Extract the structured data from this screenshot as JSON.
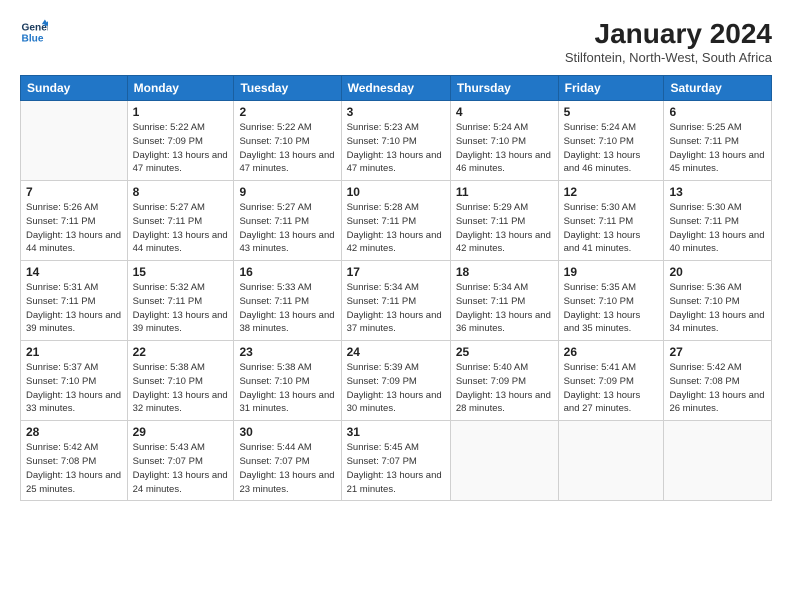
{
  "logo": {
    "line1": "General",
    "line2": "Blue"
  },
  "title": "January 2024",
  "location": "Stilfontein, North-West, South Africa",
  "days_header": [
    "Sunday",
    "Monday",
    "Tuesday",
    "Wednesday",
    "Thursday",
    "Friday",
    "Saturday"
  ],
  "weeks": [
    [
      {
        "day": "",
        "sunrise": "",
        "sunset": "",
        "daylight": ""
      },
      {
        "day": "1",
        "sunrise": "Sunrise: 5:22 AM",
        "sunset": "Sunset: 7:09 PM",
        "daylight": "Daylight: 13 hours and 47 minutes."
      },
      {
        "day": "2",
        "sunrise": "Sunrise: 5:22 AM",
        "sunset": "Sunset: 7:10 PM",
        "daylight": "Daylight: 13 hours and 47 minutes."
      },
      {
        "day": "3",
        "sunrise": "Sunrise: 5:23 AM",
        "sunset": "Sunset: 7:10 PM",
        "daylight": "Daylight: 13 hours and 47 minutes."
      },
      {
        "day": "4",
        "sunrise": "Sunrise: 5:24 AM",
        "sunset": "Sunset: 7:10 PM",
        "daylight": "Daylight: 13 hours and 46 minutes."
      },
      {
        "day": "5",
        "sunrise": "Sunrise: 5:24 AM",
        "sunset": "Sunset: 7:10 PM",
        "daylight": "Daylight: 13 hours and 46 minutes."
      },
      {
        "day": "6",
        "sunrise": "Sunrise: 5:25 AM",
        "sunset": "Sunset: 7:11 PM",
        "daylight": "Daylight: 13 hours and 45 minutes."
      }
    ],
    [
      {
        "day": "7",
        "sunrise": "Sunrise: 5:26 AM",
        "sunset": "Sunset: 7:11 PM",
        "daylight": "Daylight: 13 hours and 44 minutes."
      },
      {
        "day": "8",
        "sunrise": "Sunrise: 5:27 AM",
        "sunset": "Sunset: 7:11 PM",
        "daylight": "Daylight: 13 hours and 44 minutes."
      },
      {
        "day": "9",
        "sunrise": "Sunrise: 5:27 AM",
        "sunset": "Sunset: 7:11 PM",
        "daylight": "Daylight: 13 hours and 43 minutes."
      },
      {
        "day": "10",
        "sunrise": "Sunrise: 5:28 AM",
        "sunset": "Sunset: 7:11 PM",
        "daylight": "Daylight: 13 hours and 42 minutes."
      },
      {
        "day": "11",
        "sunrise": "Sunrise: 5:29 AM",
        "sunset": "Sunset: 7:11 PM",
        "daylight": "Daylight: 13 hours and 42 minutes."
      },
      {
        "day": "12",
        "sunrise": "Sunrise: 5:30 AM",
        "sunset": "Sunset: 7:11 PM",
        "daylight": "Daylight: 13 hours and 41 minutes."
      },
      {
        "day": "13",
        "sunrise": "Sunrise: 5:30 AM",
        "sunset": "Sunset: 7:11 PM",
        "daylight": "Daylight: 13 hours and 40 minutes."
      }
    ],
    [
      {
        "day": "14",
        "sunrise": "Sunrise: 5:31 AM",
        "sunset": "Sunset: 7:11 PM",
        "daylight": "Daylight: 13 hours and 39 minutes."
      },
      {
        "day": "15",
        "sunrise": "Sunrise: 5:32 AM",
        "sunset": "Sunset: 7:11 PM",
        "daylight": "Daylight: 13 hours and 39 minutes."
      },
      {
        "day": "16",
        "sunrise": "Sunrise: 5:33 AM",
        "sunset": "Sunset: 7:11 PM",
        "daylight": "Daylight: 13 hours and 38 minutes."
      },
      {
        "day": "17",
        "sunrise": "Sunrise: 5:34 AM",
        "sunset": "Sunset: 7:11 PM",
        "daylight": "Daylight: 13 hours and 37 minutes."
      },
      {
        "day": "18",
        "sunrise": "Sunrise: 5:34 AM",
        "sunset": "Sunset: 7:11 PM",
        "daylight": "Daylight: 13 hours and 36 minutes."
      },
      {
        "day": "19",
        "sunrise": "Sunrise: 5:35 AM",
        "sunset": "Sunset: 7:10 PM",
        "daylight": "Daylight: 13 hours and 35 minutes."
      },
      {
        "day": "20",
        "sunrise": "Sunrise: 5:36 AM",
        "sunset": "Sunset: 7:10 PM",
        "daylight": "Daylight: 13 hours and 34 minutes."
      }
    ],
    [
      {
        "day": "21",
        "sunrise": "Sunrise: 5:37 AM",
        "sunset": "Sunset: 7:10 PM",
        "daylight": "Daylight: 13 hours and 33 minutes."
      },
      {
        "day": "22",
        "sunrise": "Sunrise: 5:38 AM",
        "sunset": "Sunset: 7:10 PM",
        "daylight": "Daylight: 13 hours and 32 minutes."
      },
      {
        "day": "23",
        "sunrise": "Sunrise: 5:38 AM",
        "sunset": "Sunset: 7:10 PM",
        "daylight": "Daylight: 13 hours and 31 minutes."
      },
      {
        "day": "24",
        "sunrise": "Sunrise: 5:39 AM",
        "sunset": "Sunset: 7:09 PM",
        "daylight": "Daylight: 13 hours and 30 minutes."
      },
      {
        "day": "25",
        "sunrise": "Sunrise: 5:40 AM",
        "sunset": "Sunset: 7:09 PM",
        "daylight": "Daylight: 13 hours and 28 minutes."
      },
      {
        "day": "26",
        "sunrise": "Sunrise: 5:41 AM",
        "sunset": "Sunset: 7:09 PM",
        "daylight": "Daylight: 13 hours and 27 minutes."
      },
      {
        "day": "27",
        "sunrise": "Sunrise: 5:42 AM",
        "sunset": "Sunset: 7:08 PM",
        "daylight": "Daylight: 13 hours and 26 minutes."
      }
    ],
    [
      {
        "day": "28",
        "sunrise": "Sunrise: 5:42 AM",
        "sunset": "Sunset: 7:08 PM",
        "daylight": "Daylight: 13 hours and 25 minutes."
      },
      {
        "day": "29",
        "sunrise": "Sunrise: 5:43 AM",
        "sunset": "Sunset: 7:07 PM",
        "daylight": "Daylight: 13 hours and 24 minutes."
      },
      {
        "day": "30",
        "sunrise": "Sunrise: 5:44 AM",
        "sunset": "Sunset: 7:07 PM",
        "daylight": "Daylight: 13 hours and 23 minutes."
      },
      {
        "day": "31",
        "sunrise": "Sunrise: 5:45 AM",
        "sunset": "Sunset: 7:07 PM",
        "daylight": "Daylight: 13 hours and 21 minutes."
      },
      {
        "day": "",
        "sunrise": "",
        "sunset": "",
        "daylight": ""
      },
      {
        "day": "",
        "sunrise": "",
        "sunset": "",
        "daylight": ""
      },
      {
        "day": "",
        "sunrise": "",
        "sunset": "",
        "daylight": ""
      }
    ]
  ]
}
